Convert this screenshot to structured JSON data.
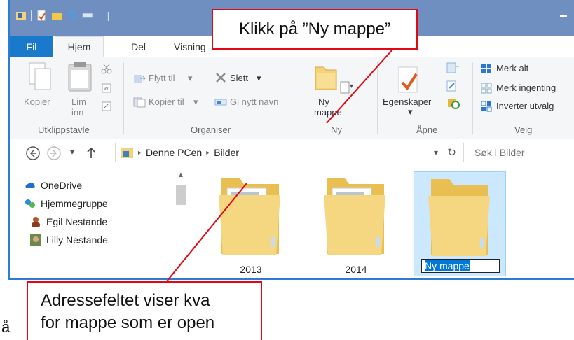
{
  "titlebar": {
    "qat_separator": "|",
    "dropdown_glyph": "="
  },
  "tabs": [
    {
      "label": "Fil"
    },
    {
      "label": "Hjem"
    },
    {
      "label": "Del"
    },
    {
      "label": "Visning"
    }
  ],
  "ribbon": {
    "clipboard": {
      "copy": "Kopier",
      "paste_line1": "Lim",
      "paste_line2": "inn",
      "label": "Utklippstavle"
    },
    "organize": {
      "move": "Flytt til",
      "copy_to": "Kopier til",
      "delete": "Slett",
      "rename": "Gi nytt navn",
      "label": "Organiser"
    },
    "new": {
      "folder_line1": "Ny",
      "folder_line2": "mappe",
      "label": "Ny"
    },
    "open": {
      "properties": "Egenskaper",
      "label": "Åpne"
    },
    "select": {
      "all": "Merk alt",
      "none": "Merk ingenting",
      "invert": "Inverter utvalg",
      "label": "Velg"
    }
  },
  "address": {
    "path": [
      "Denne PCen",
      "Bilder"
    ],
    "search_placeholder": "Søk i Bilder"
  },
  "nav": [
    {
      "label": "OneDrive"
    },
    {
      "label": "Hjemmegruppe"
    },
    {
      "label": "Egil Nestande"
    },
    {
      "label": "Lilly Nestande"
    }
  ],
  "files": [
    {
      "name": "2013"
    },
    {
      "name": "2014"
    },
    {
      "name": "Ny mappe"
    }
  ],
  "callouts": {
    "top": "Klikk på ”Ny mappe”",
    "bottom_line1": "Adressefeltet viser kva",
    "bottom_line2": "for mappe som er open"
  },
  "stray_char": "å",
  "colors": {
    "accent": "#1979ca",
    "callout_border": "#e30613",
    "selection": "#cce8ff"
  }
}
